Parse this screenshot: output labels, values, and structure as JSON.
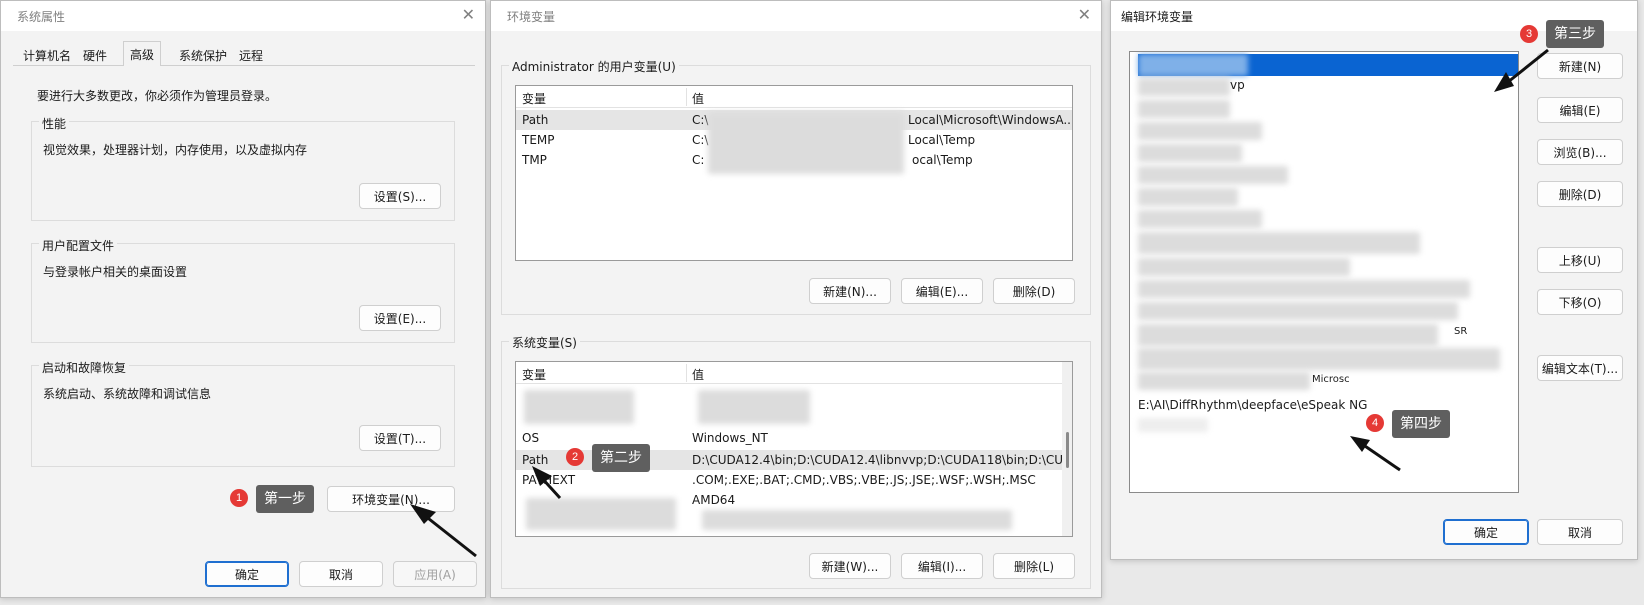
{
  "colors": {
    "accent": "#0a64d2",
    "badge": "#e53935",
    "tooltip": "#5f5f5f"
  },
  "sys_props": {
    "title": "系统属性",
    "tabs": [
      "计算机名",
      "硬件",
      "高级",
      "系统保护",
      "远程"
    ],
    "admin_notice": "要进行大多数更改，你必须作为管理员登录。",
    "perf": {
      "label": "性能",
      "desc": "视觉效果，处理器计划，内存使用，以及虚拟内存",
      "button": "设置(S)..."
    },
    "profile": {
      "label": "用户配置文件",
      "desc": "与登录帐户相关的桌面设置",
      "button": "设置(E)..."
    },
    "startup": {
      "label": "启动和故障恢复",
      "desc": "系统启动、系统故障和调试信息",
      "button": "设置(T)..."
    },
    "env_button": "环境变量(N)...",
    "ok": "确定",
    "cancel": "取消",
    "apply": "应用(A)"
  },
  "env_vars": {
    "title": "环境变量",
    "user_group": "Administrator 的用户变量(U)",
    "sys_group": "系统变量(S)",
    "col_var": "变量",
    "col_val": "值",
    "user_rows": [
      {
        "name": "Path",
        "prefix": "C:\\",
        "suffix": "Local\\Microsoft\\WindowsA..."
      },
      {
        "name": "TEMP",
        "prefix": "C:\\",
        "suffix": "Local\\Temp"
      },
      {
        "name": "TMP",
        "prefix": "C:",
        "suffix": "ocal\\Temp"
      }
    ],
    "sys_rows": [
      {
        "name": "OS",
        "value": "Windows_NT"
      },
      {
        "name": "Path",
        "value": "D:\\CUDA12.4\\bin;D:\\CUDA12.4\\libnvvp;D:\\CUDA118\\bin;D:\\CU..."
      },
      {
        "name": "PATHEXT",
        "value": ".COM;.EXE;.BAT;.CMD;.VBS;.VBE;.JS;.JSE;.WSF;.WSH;.MSC"
      },
      {
        "name": "",
        "value": "AMD64"
      }
    ],
    "user_buttons": {
      "new": "新建(N)...",
      "edit": "编辑(E)...",
      "delete": "删除(D)"
    },
    "sys_buttons": {
      "new": "新建(W)...",
      "edit": "编辑(I)...",
      "delete": "删除(L)"
    }
  },
  "edit_env": {
    "title": "编辑环境变量",
    "fragments": {
      "row2": "vp",
      "row14": "Microsc",
      "row_sr": "SR"
    },
    "last_entry": "E:\\AI\\DiffRhythm\\deepface\\eSpeak NG",
    "buttons": {
      "new": "新建(N)",
      "edit": "编辑(E)",
      "browse": "浏览(B)...",
      "delete": "删除(D)",
      "up": "上移(U)",
      "down": "下移(O)",
      "edit_text": "编辑文本(T)...",
      "ok": "确定",
      "cancel": "取消"
    }
  },
  "steps": {
    "s1": "1",
    "s1_label": "第一步",
    "s2": "2",
    "s2_label": "第二步",
    "s3": "3",
    "s3_label": "第三步",
    "s4": "4",
    "s4_label": "第四步"
  }
}
